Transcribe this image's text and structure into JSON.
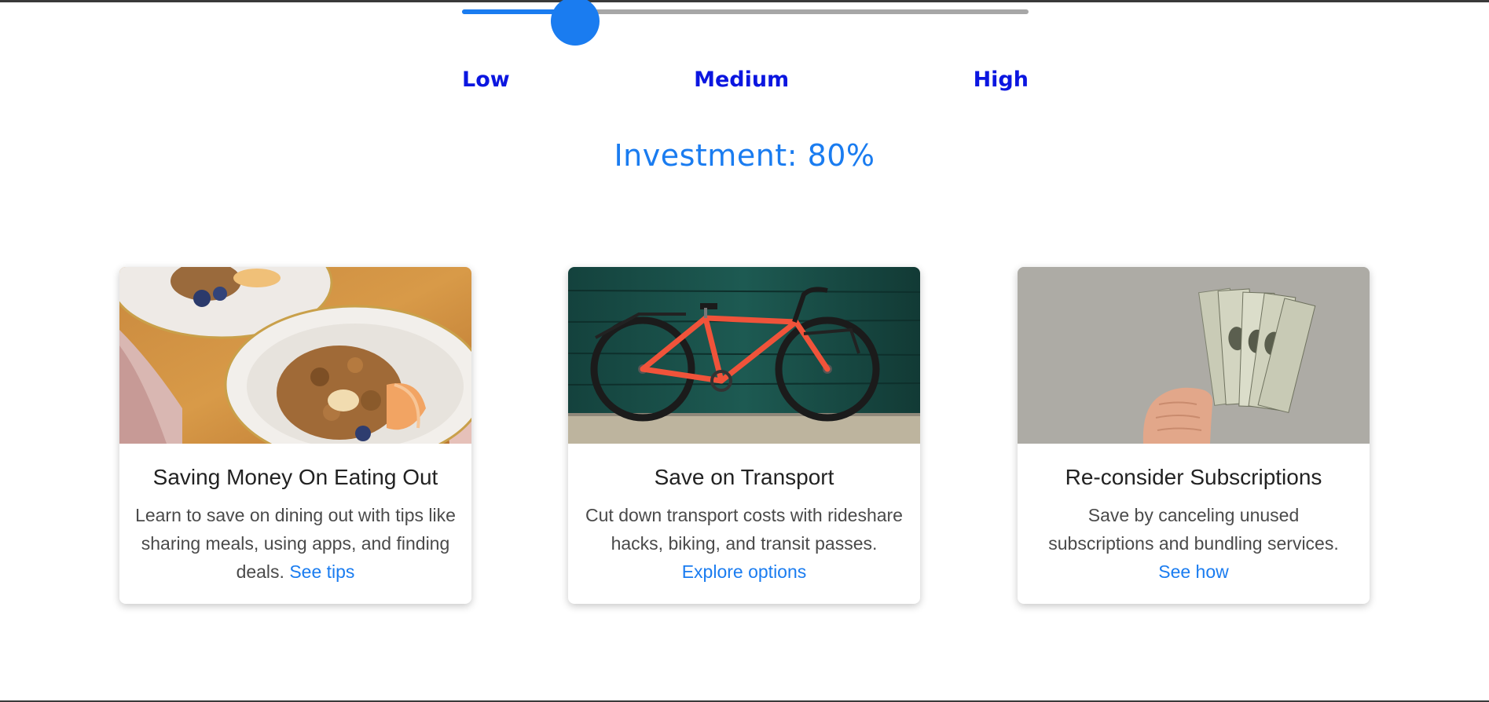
{
  "slider": {
    "value_percent": 20,
    "accent_color": "#1a7cf0",
    "track_color": "#a7a7a7"
  },
  "levels": [
    "Low",
    "Medium",
    "High"
  ],
  "investment_text": "Investment: 80%",
  "cards": [
    {
      "title": "Saving Money On Eating Out",
      "text": "Learn to save on dining out with tips like sharing meals, using apps, and finding deals.",
      "link": "See tips",
      "image": "granola-bowl-image"
    },
    {
      "title": "Save on Transport",
      "text": "Cut down transport costs with rideshare hacks, biking, and transit passes.",
      "link": "Explore options",
      "image": "red-bicycle-image"
    },
    {
      "title": "Re-consider Subscriptions",
      "text": "Save by canceling unused subscriptions and bundling services.",
      "link": "See how",
      "image": "cash-in-hand-image"
    }
  ],
  "colors": {
    "level_label": "#0b16e0",
    "investment": "#1a7cf0",
    "link": "#1a7cf0"
  }
}
